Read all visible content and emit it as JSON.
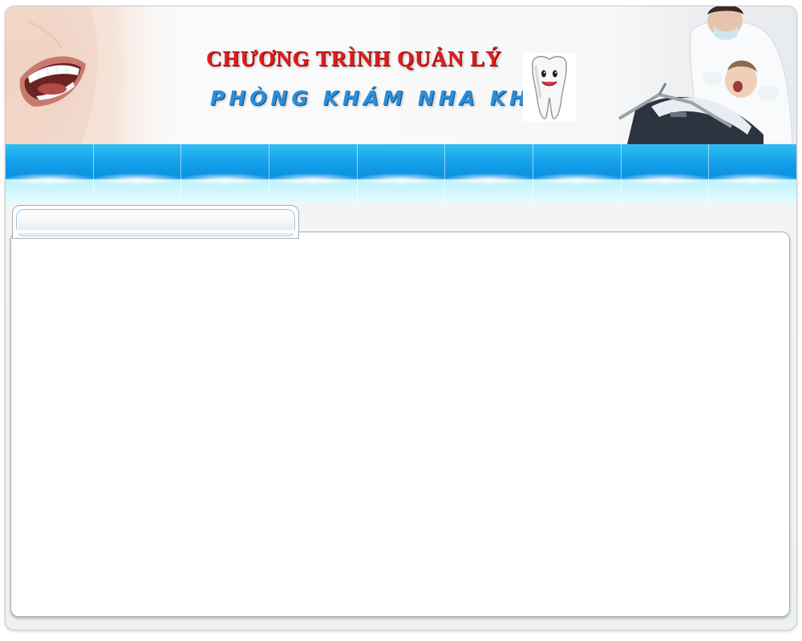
{
  "header": {
    "title_line1": "CHƯƠNG TRÌNH QUẢN LÝ",
    "title_line2": "PHÒNG KHÁM NHA KHOA",
    "accent_red": "#e31b1b",
    "accent_blue": "#2a8fdc",
    "images": {
      "left": "smiling-woman-teeth-photo",
      "right": "dentist-treating-patient-photo",
      "mascot": "cartoon-tooth-icon"
    }
  },
  "nav": {
    "items": [
      {
        "label": ""
      },
      {
        "label": ""
      },
      {
        "label": ""
      },
      {
        "label": ""
      },
      {
        "label": ""
      },
      {
        "label": ""
      },
      {
        "label": ""
      },
      {
        "label": ""
      },
      {
        "label": ""
      }
    ],
    "color": "#13a0ea"
  },
  "panel": {
    "tab_title": "",
    "content": ""
  }
}
